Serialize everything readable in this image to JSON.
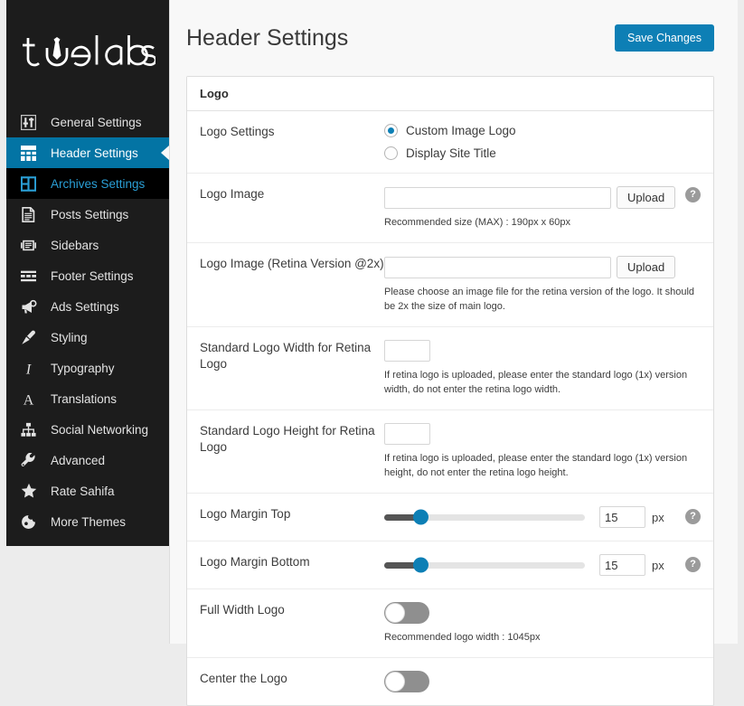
{
  "sidebar": {
    "brand": "tielabs",
    "items": [
      {
        "label": "General Settings",
        "icon": "sliders-icon",
        "state": "normal"
      },
      {
        "label": "Header Settings",
        "icon": "layout-header-icon",
        "state": "active"
      },
      {
        "label": "Archives Settings",
        "icon": "archive-box-icon",
        "state": "hovered"
      },
      {
        "label": "Posts Settings",
        "icon": "document-icon",
        "state": "normal"
      },
      {
        "label": "Sidebars",
        "icon": "sidebar-columns-icon",
        "state": "normal"
      },
      {
        "label": "Footer Settings",
        "icon": "layout-footer-icon",
        "state": "normal"
      },
      {
        "label": "Ads Settings",
        "icon": "megaphone-icon",
        "state": "normal"
      },
      {
        "label": "Styling",
        "icon": "paint-brush-icon",
        "state": "normal"
      },
      {
        "label": "Typography",
        "icon": "italic-text-icon",
        "state": "normal"
      },
      {
        "label": "Translations",
        "icon": "letter-a-icon",
        "state": "normal"
      },
      {
        "label": "Social Networking",
        "icon": "sitemap-icon",
        "state": "normal"
      },
      {
        "label": "Advanced",
        "icon": "wrench-icon",
        "state": "normal"
      },
      {
        "label": "Rate Sahifa",
        "icon": "star-icon",
        "state": "normal"
      },
      {
        "label": "More Themes",
        "icon": "themes-icon",
        "state": "normal"
      }
    ]
  },
  "header": {
    "title": "Header Settings",
    "save_label": "Save Changes"
  },
  "panel": {
    "title": "Logo",
    "rows": {
      "logo_settings": {
        "label": "Logo Settings",
        "options": [
          {
            "label": "Custom Image Logo",
            "selected": true
          },
          {
            "label": "Display Site Title",
            "selected": false
          }
        ]
      },
      "logo_image": {
        "label": "Logo Image",
        "value": "",
        "upload_label": "Upload",
        "desc": "Recommended size (MAX) : 190px x 60px",
        "help": "?"
      },
      "logo_image_retina": {
        "label": "Logo Image (Retina Version @2x)",
        "value": "",
        "upload_label": "Upload",
        "desc": "Please choose an image file for the retina version of the logo. It should be 2x the size of main logo."
      },
      "retina_width": {
        "label": "Standard Logo Width for Retina Logo",
        "value": "",
        "desc": "If retina logo is uploaded, please enter the standard logo (1x) version width, do not enter the retina logo width."
      },
      "retina_height": {
        "label": "Standard Logo Height for Retina Logo",
        "value": "",
        "desc": "If retina logo is uploaded, please enter the standard logo (1x) version height, do not enter the retina logo height."
      },
      "margin_top": {
        "label": "Logo Margin Top",
        "value": "15",
        "unit": "px",
        "percent": 18,
        "help": "?"
      },
      "margin_bottom": {
        "label": "Logo Margin Bottom",
        "value": "15",
        "unit": "px",
        "percent": 18,
        "help": "?"
      },
      "full_width_logo": {
        "label": "Full Width Logo",
        "state": "off",
        "desc": "Recommended logo width : 1045px"
      },
      "center_logo": {
        "label": "Center the Logo",
        "state": "off"
      }
    }
  },
  "colors": {
    "accent": "#0d7fb5",
    "sidebar_bg": "#1c1c1c",
    "active_item": "#0374a4",
    "hover_text": "#2a9fd6",
    "slider_fill": "#555555",
    "toggle_off": "#8f8f8f",
    "page_bg": "#ececec"
  }
}
